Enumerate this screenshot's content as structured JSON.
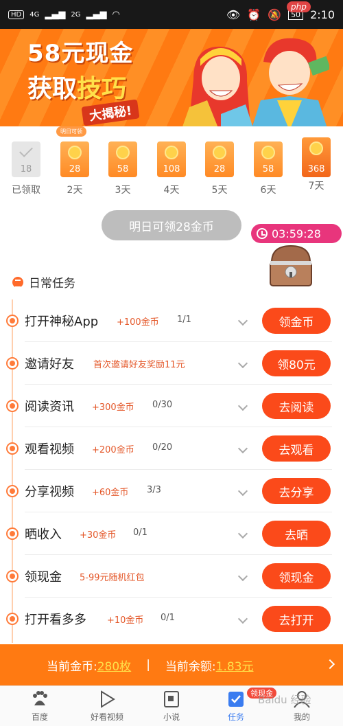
{
  "status_bar": {
    "left_icons": [
      "HD",
      "4G",
      "2G"
    ],
    "time": "2:10",
    "battery": "50"
  },
  "watermark_logo": "php",
  "banner": {
    "line1": "58元现金",
    "line2_a": "获取",
    "line2_b": "技巧",
    "tag": "大揭秘!"
  },
  "checkin": {
    "tomorrow_tag": "明日可领",
    "days": [
      {
        "value": "18",
        "label": "已领取",
        "state": "done"
      },
      {
        "value": "28",
        "label": "2天",
        "state": "next"
      },
      {
        "value": "58",
        "label": "3天",
        "state": "pending"
      },
      {
        "value": "108",
        "label": "4天",
        "state": "pending"
      },
      {
        "value": "28",
        "label": "5天",
        "state": "pending"
      },
      {
        "value": "58",
        "label": "6天",
        "state": "pending"
      },
      {
        "value": "368",
        "label": "7天",
        "state": "big"
      }
    ],
    "pill_text": "明日可领28金币",
    "timer": "03:59:28"
  },
  "section_title": "日常任务",
  "tasks": [
    {
      "name": "打开神秘App",
      "reward": "+100金币",
      "progress": "1/1",
      "button": "领金币",
      "icon": "app-icon"
    },
    {
      "name": "邀请好友",
      "reward": "首次邀请好友奖励11元",
      "progress": "",
      "button": "领80元",
      "icon": "person-icon"
    },
    {
      "name": "阅读资讯",
      "reward": "+300金币",
      "progress": "0/30",
      "button": "去阅读",
      "icon": "news-icon"
    },
    {
      "name": "观看视频",
      "reward": "+200金币",
      "progress": "0/20",
      "button": "去观看",
      "icon": "play-icon"
    },
    {
      "name": "分享视频",
      "reward": "+60金币",
      "progress": "3/3",
      "button": "去分享",
      "icon": "share-icon"
    },
    {
      "name": "晒收入",
      "reward": "+30金币",
      "progress": "0/1",
      "button": "去晒",
      "icon": "yen-icon"
    },
    {
      "name": "领现金",
      "reward": "5-99元随机红包",
      "progress": "",
      "button": "领现金",
      "icon": "lock-icon"
    },
    {
      "name": "打开看多多",
      "reward": "+10金币",
      "progress": "0/1",
      "button": "去打开",
      "icon": "target-icon"
    }
  ],
  "coinbar": {
    "coins_label": "当前金币:",
    "coins_value": "280枚",
    "divider": "|",
    "balance_label": "当前余额:",
    "balance_value": "1.83元"
  },
  "nav": {
    "items": [
      {
        "label": "百度",
        "icon": "paw-icon"
      },
      {
        "label": "好看视频",
        "icon": "play-icon"
      },
      {
        "label": "小说",
        "icon": "book-icon"
      },
      {
        "label": "任务",
        "icon": "task-check-icon"
      },
      {
        "label": "我的",
        "icon": "person-icon"
      }
    ],
    "badge": "领现金"
  },
  "watermark_text": "Baidu 经验"
}
